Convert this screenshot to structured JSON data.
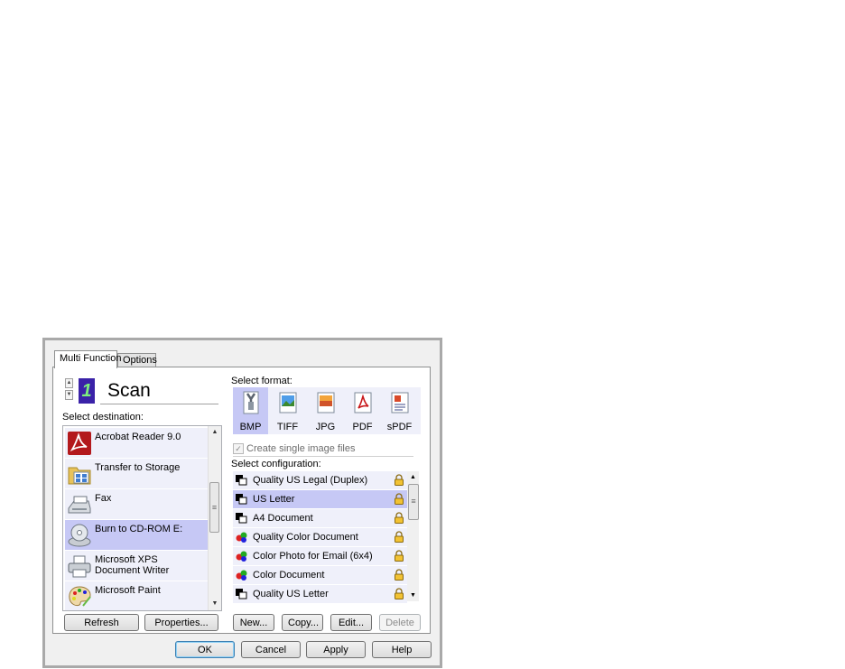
{
  "tabs": [
    {
      "label": "Multi Function",
      "active": true
    },
    {
      "label": "Options",
      "active": false
    }
  ],
  "scan": {
    "title": "Scan",
    "icon": "scan-digit-icon",
    "digit": "1"
  },
  "destination": {
    "label": "Select destination:",
    "items": [
      {
        "label": "Acrobat Reader 9.0",
        "icon": "acrobat-icon",
        "selected": false
      },
      {
        "label": "Transfer to Storage",
        "icon": "folder-storage-icon",
        "selected": false
      },
      {
        "label": "Fax",
        "icon": "fax-icon",
        "selected": false
      },
      {
        "label": "Burn to CD-ROM  E:",
        "icon": "cd-burn-icon",
        "selected": true
      },
      {
        "label": "Microsoft XPS Document Writer",
        "icon": "printer-icon",
        "selected": false
      },
      {
        "label": "Microsoft Paint",
        "icon": "paint-palette-icon",
        "selected": false
      }
    ],
    "refresh_label": "Refresh",
    "properties_label": "Properties..."
  },
  "format": {
    "label": "Select format:",
    "items": [
      {
        "label": "BMP",
        "icon": "bmp-icon",
        "selected": true
      },
      {
        "label": "TIFF",
        "icon": "tiff-icon",
        "selected": false
      },
      {
        "label": "JPG",
        "icon": "jpg-icon",
        "selected": false
      },
      {
        "label": "PDF",
        "icon": "pdf-icon",
        "selected": false
      },
      {
        "label": "sPDF",
        "icon": "spdf-icon",
        "selected": false
      }
    ],
    "single_image_label": "Create single image files",
    "single_image_checked": true
  },
  "configuration": {
    "label": "Select configuration:",
    "items": [
      {
        "label": "Quality US Legal (Duplex)",
        "icon": "bw-scan-icon",
        "selected": false
      },
      {
        "label": "US Letter",
        "icon": "bw-scan-icon",
        "selected": true
      },
      {
        "label": "A4 Document",
        "icon": "bw-scan-icon",
        "selected": false
      },
      {
        "label": "Quality Color Document",
        "icon": "color-scan-icon",
        "selected": false
      },
      {
        "label": "Color Photo for Email (6x4)",
        "icon": "color-scan-icon",
        "selected": false
      },
      {
        "label": "Color Document",
        "icon": "color-scan-icon",
        "selected": false
      },
      {
        "label": "Quality US Letter",
        "icon": "bw-scan-icon",
        "selected": false
      }
    ],
    "new_label": "New...",
    "copy_label": "Copy...",
    "edit_label": "Edit...",
    "delete_label": "Delete"
  },
  "dialog_buttons": {
    "ok": "OK",
    "cancel": "Cancel",
    "apply": "Apply",
    "help": "Help"
  },
  "colors": {
    "selected": "#c6c8f5",
    "item_bg": "#eff0fa",
    "scan_icon": "#3a22a8"
  }
}
